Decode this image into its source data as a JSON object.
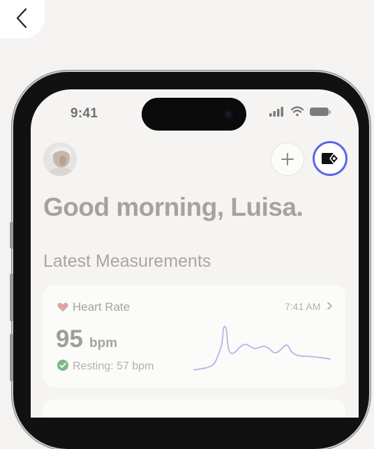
{
  "nav": {
    "back_icon": "chevron-left-icon"
  },
  "status_bar": {
    "time": "9:41"
  },
  "header": {
    "avatar_icon": "user-avatar",
    "add_icon": "plus-icon",
    "wallet_icon": "wallet-icon",
    "accent": "#5a67e6"
  },
  "greeting": "Good morning, Luisa.",
  "section_title": "Latest Measurements",
  "heart_rate_card": {
    "title": "Heart Rate",
    "time": "7:41 AM",
    "value": "95",
    "unit": "bpm",
    "resting": "Resting: 57 bpm",
    "heart_color": "#e0a3a3",
    "check_color": "#7bb88a",
    "line_color": "#b9bde6"
  }
}
